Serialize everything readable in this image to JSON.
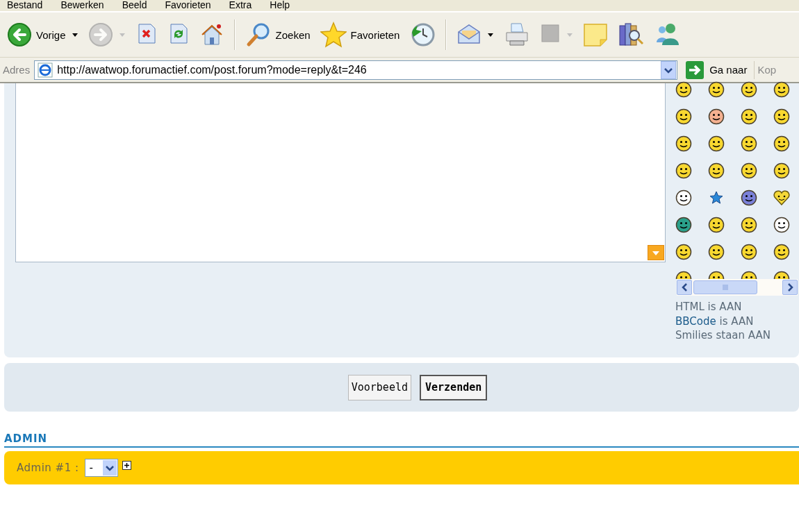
{
  "menu_bar": {
    "items": [
      "Bestand",
      "Bewerken",
      "Beeld",
      "Favorieten",
      "Extra",
      "Help"
    ]
  },
  "toolbar": {
    "buttons": [
      {
        "kind": "back",
        "label": "Vorige",
        "dropdown": true,
        "disabled": false
      },
      {
        "kind": "forward",
        "dropdown": true,
        "disabled": true
      },
      {
        "kind": "stop",
        "disabled": false
      },
      {
        "kind": "refresh",
        "disabled": false
      },
      {
        "kind": "home",
        "disabled": false
      },
      {
        "kind": "separator"
      },
      {
        "kind": "search",
        "label": "Zoeken",
        "disabled": false
      },
      {
        "kind": "favorites",
        "label": "Favorieten",
        "disabled": false
      },
      {
        "kind": "history",
        "disabled": false
      },
      {
        "kind": "separator"
      },
      {
        "kind": "mail",
        "dropdown": true,
        "disabled": false
      },
      {
        "kind": "print",
        "disabled": false
      },
      {
        "kind": "edit",
        "dropdown": true,
        "disabled": true
      },
      {
        "kind": "note",
        "disabled": false
      },
      {
        "kind": "research",
        "disabled": false
      },
      {
        "kind": "messenger",
        "disabled": false
      }
    ]
  },
  "address_bar": {
    "label": "Adres",
    "url": "http://awatwop.forumactief.com/post.forum?mode=reply&t=246",
    "go_button": "Ga naar",
    "links_label": "Kop"
  },
  "status_lines": [
    {
      "text": "HTML is AAN"
    },
    {
      "link": "BBCode",
      "text": " is AAN"
    },
    {
      "text": "Smilies staan AAN"
    }
  ],
  "buttons": [
    {
      "label": "Voorbeeld",
      "default": false
    },
    {
      "label": "Verzenden",
      "default": true
    }
  ],
  "admin": {
    "heading": "ADMIN",
    "field_label": "Admin #1 :",
    "select_value": "-"
  }
}
